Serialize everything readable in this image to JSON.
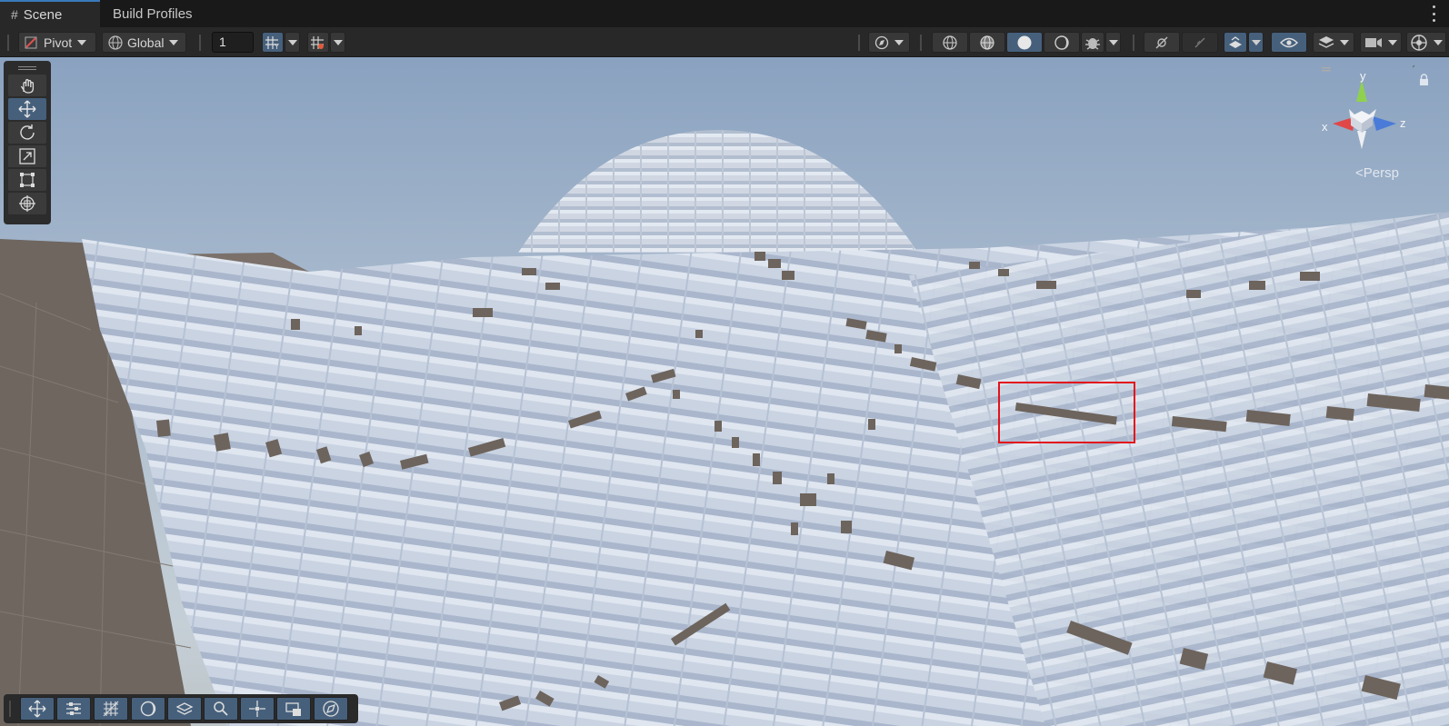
{
  "tabs": [
    {
      "label": "Scene",
      "icon": "hash-grid-icon",
      "active": true
    },
    {
      "label": "Build Profiles",
      "active": false
    }
  ],
  "toolbar": {
    "pivot_label": "Pivot",
    "global_label": "Global",
    "snap_increment_value": "1",
    "icons": [
      "grid-snap-icon",
      "snap-settings-icon",
      "draw-mode-icon",
      "wireframe-icon",
      "shaded-wireframe-icon",
      "shaded-icon",
      "unlit-icon",
      "debug-icon",
      "lighting-toggle-icon",
      "audio-toggle-icon",
      "effects-icon",
      "visibility-icon",
      "layers-icon",
      "camera-icon",
      "gizmos-icon"
    ]
  },
  "tools": [
    "hand-tool-icon",
    "move-tool-icon",
    "rotate-tool-icon",
    "scale-tool-icon",
    "rect-tool-icon",
    "transform-tool-icon"
  ],
  "selected_tool": "move-tool-icon",
  "overlay_toolbar": [
    "move-icon",
    "tool-settings-icon",
    "grid-icon",
    "lighting-icon",
    "layers-icon",
    "search-icon",
    "pivot-icon",
    "camera-preview-icon",
    "navigation-icon"
  ],
  "gizmo": {
    "x_label": "x",
    "y_label": "y",
    "z_label": "z",
    "projection_label": "<Persp"
  },
  "colors": {
    "accent_blue": "#46607c",
    "highlight_red": "#e3131b",
    "sky_top": "#8aa2c0",
    "terrain": "#c8d2e0",
    "ground": "#6f6660"
  }
}
